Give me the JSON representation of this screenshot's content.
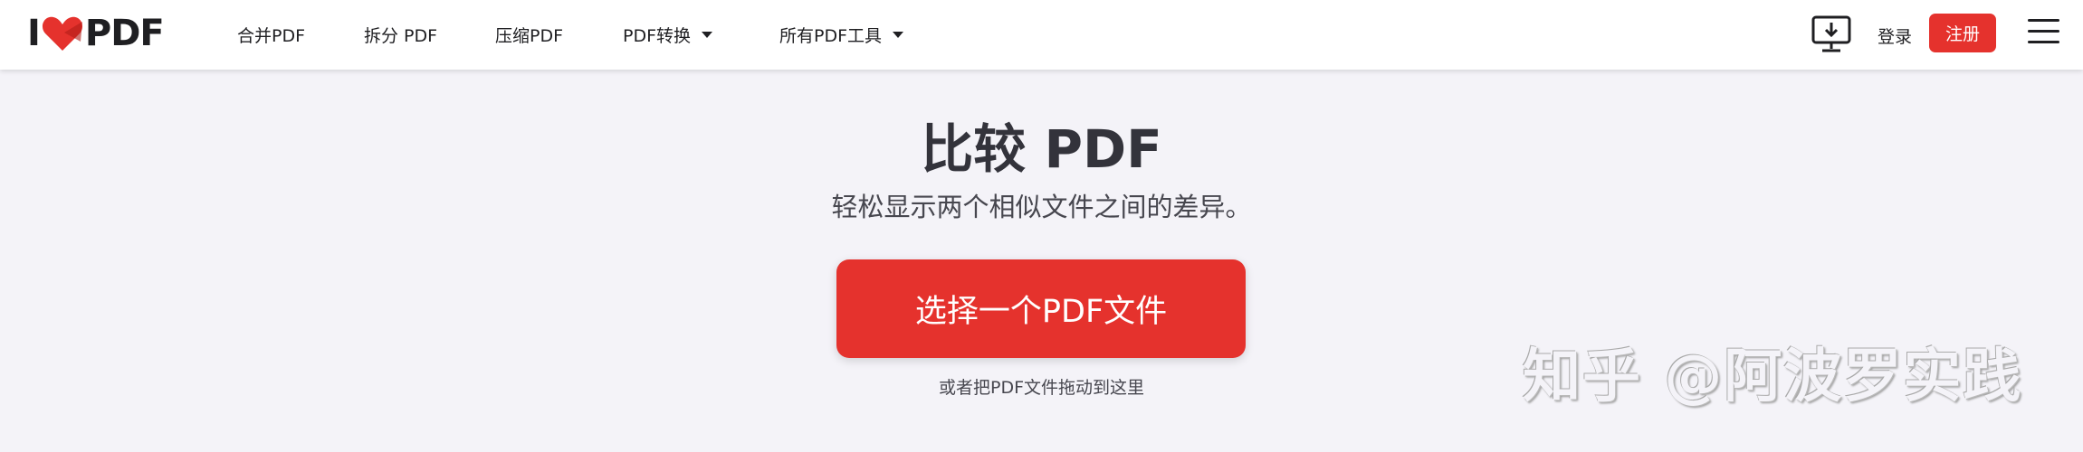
{
  "header": {
    "logo_left": "I",
    "logo_right": "PDF",
    "nav": [
      {
        "label": "合并PDF"
      },
      {
        "label": "拆分 PDF"
      },
      {
        "label": "压缩PDF"
      },
      {
        "label": "PDF转换"
      },
      {
        "label": "所有PDF工具"
      }
    ],
    "login_label": "登录",
    "signup_label": "注册"
  },
  "main": {
    "title": "比较 PDF",
    "subtitle": "轻松显示两个相似文件之间的差异。",
    "select_button_label": "选择一个PDF文件",
    "drop_hint": "或者把PDF文件拖动到这里"
  },
  "watermark": "知乎 @阿波罗实践",
  "colors": {
    "accent": "#e5322d",
    "background": "#f4f3f8",
    "header": "#ffffff"
  },
  "icons": {
    "logo": "heart-icon",
    "desktop": "desktop-download-icon",
    "menu": "hamburger-menu-icon",
    "dropdown": "caret-down-icon"
  }
}
